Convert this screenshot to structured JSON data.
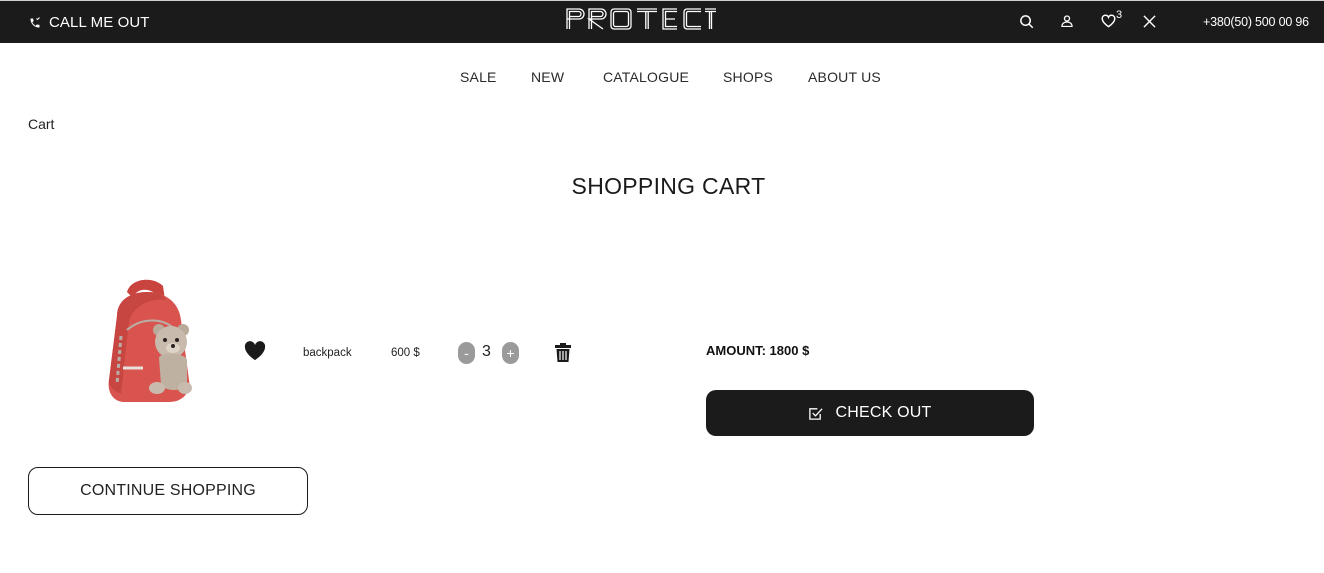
{
  "topbar": {
    "call_label": "CALL ME OUT",
    "logo": "PROTECT",
    "favorites_count": "3",
    "phone": "+380(50) 500 00 96",
    "icons": [
      "phone-icon",
      "search-icon",
      "user-icon",
      "heart-outline-icon",
      "close-icon"
    ]
  },
  "nav": {
    "items": [
      {
        "label": "SALE"
      },
      {
        "label": "NEW"
      },
      {
        "label": "CATALOGUE"
      },
      {
        "label": "SHOPS"
      },
      {
        "label": "ABOUT US"
      }
    ]
  },
  "breadcrumb": "Cart",
  "page_title": "SHOPPING CART",
  "cart": {
    "items": [
      {
        "name": "backpack",
        "price": "600 $",
        "quantity": "3",
        "minus": "-",
        "plus": "+"
      }
    ],
    "amount_label": "AMOUNT: 1800 $",
    "checkout_label": "CHECK OUT",
    "continue_label": "CONTINUE SHOPPING"
  },
  "colors": {
    "topbar_bg": "#1c1b1b",
    "button_dark": "#1c1b1b",
    "stepper_gray": "#9a9a9a",
    "product_red": "#d9544f"
  }
}
